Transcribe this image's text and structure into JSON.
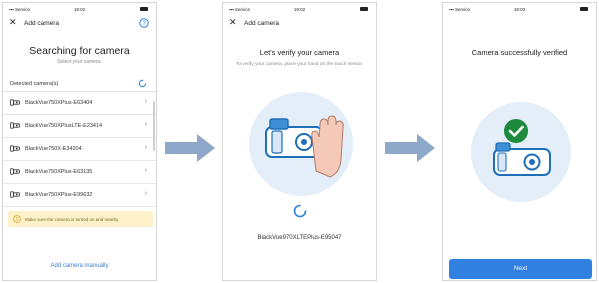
{
  "colors": {
    "accent": "#2f80e0",
    "arrow": "#8ea8c9",
    "illustration_circle": "#e3eef9",
    "warning_bg": "#fdf1c9",
    "success": "#1e8a3d"
  },
  "screen1": {
    "status": {
      "carrier": "▪▪▪ Service",
      "time": "19:02"
    },
    "nav": {
      "title": "Add camera",
      "close_icon": "close-icon",
      "help_icon": "help-icon"
    },
    "heading": "Searching for camera",
    "subheading": "Select your camera.",
    "detected_label": "Detected camera(s)",
    "cameras": [
      {
        "name": "BlackVue750XPlus-E63404"
      },
      {
        "name": "BlackVue750XPlusLTE-E23414"
      },
      {
        "name": "BlackVue750X-E34204"
      },
      {
        "name": "BlackVue750XPlus-E63135"
      },
      {
        "name": "BlackVue750XPlus-E99632"
      }
    ],
    "warning": "Make sure the camera is turned on and nearby.",
    "add_manually": "Add camera manually"
  },
  "screen2": {
    "status": {
      "carrier": "▪▪▪ Service",
      "time": "19:02"
    },
    "nav": {
      "title": "Add camera"
    },
    "heading": "Let's verify your camera",
    "description": "To verify your camera, place your hand on the touch sensor.",
    "camera_name": "BlackVue970XLTEPlus-E95047"
  },
  "screen3": {
    "status": {
      "carrier": "▪▪▪ Service",
      "time": "18:03"
    },
    "heading": "Camera successfully verified",
    "next_label": "Next"
  }
}
